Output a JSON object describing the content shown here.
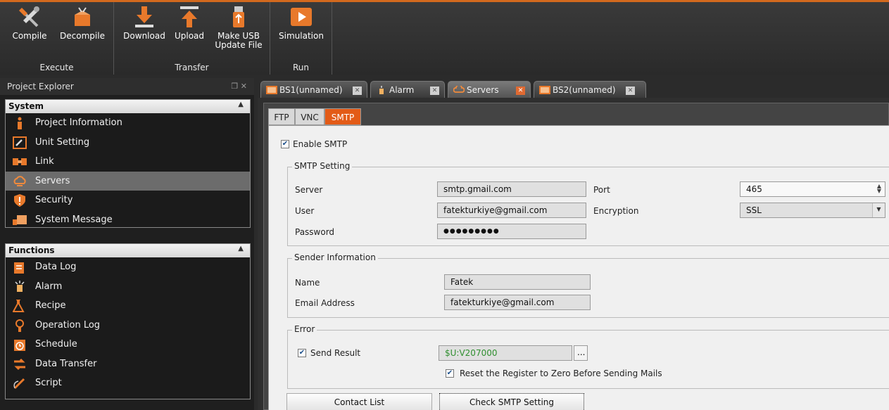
{
  "ribbon": {
    "groups": [
      {
        "label": "Execute",
        "buttons": [
          {
            "label": "Compile"
          },
          {
            "label": "Decompile"
          }
        ]
      },
      {
        "label": "Transfer",
        "buttons": [
          {
            "label": "Download"
          },
          {
            "label": "Upload"
          },
          {
            "label": "Make USB Update File"
          }
        ]
      },
      {
        "label": "Run",
        "buttons": [
          {
            "label": "Simulation"
          }
        ]
      }
    ],
    "accent_color": "#e8792b"
  },
  "explorer": {
    "title": "Project Explorer",
    "controls": "❐ ✕",
    "sections": [
      {
        "title": "System",
        "items": [
          {
            "label": "Project Information",
            "icon": "info-icon"
          },
          {
            "label": "Unit Setting",
            "icon": "wrench-icon"
          },
          {
            "label": "Link",
            "icon": "link-icon"
          },
          {
            "label": "Servers",
            "icon": "cloud-icon",
            "selected": true
          },
          {
            "label": "Security",
            "icon": "shield-icon"
          },
          {
            "label": "System Message",
            "icon": "message-icon"
          }
        ]
      },
      {
        "title": "Functions",
        "items": [
          {
            "label": "Data Log",
            "icon": "datalog-icon"
          },
          {
            "label": "Alarm",
            "icon": "alarm-icon"
          },
          {
            "label": "Recipe",
            "icon": "recipe-icon"
          },
          {
            "label": "Operation Log",
            "icon": "operation-log-icon"
          },
          {
            "label": "Schedule",
            "icon": "clock-icon"
          },
          {
            "label": "Data Transfer",
            "icon": "transfer-icon"
          },
          {
            "label": "Script",
            "icon": "script-icon"
          }
        ]
      }
    ]
  },
  "tabs": [
    {
      "label": "BS1(unnamed)",
      "icon": "screen-icon"
    },
    {
      "label": "Alarm",
      "icon": "alarm-icon"
    },
    {
      "label": "Servers",
      "icon": "cloud-icon",
      "active": true
    },
    {
      "label": "BS2(unnamed)",
      "icon": "screen-icon"
    }
  ],
  "subtabs": [
    {
      "label": "FTP"
    },
    {
      "label": "VNC"
    },
    {
      "label": "SMTP",
      "active": true
    }
  ],
  "smtp": {
    "enable_label": "Enable SMTP",
    "enable_checked": true,
    "setting": {
      "legend": "SMTP Setting",
      "server_label": "Server",
      "server_value": "smtp.gmail.com",
      "port_label": "Port",
      "port_value": "465",
      "user_label": "User",
      "user_value": "fatekturkiye@gmail.com",
      "encryption_label": "Encryption",
      "encryption_value": "SSL",
      "password_label": "Password",
      "password_value": "●●●●●●●●●"
    },
    "sender": {
      "legend": "Sender Information",
      "name_label": "Name",
      "name_value": "Fatek",
      "email_label": "Email Address",
      "email_value": "fatekturkiye@gmail.com"
    },
    "error": {
      "legend": "Error",
      "send_result_label": "Send Result",
      "send_result_checked": true,
      "register_value": "$U:V207000",
      "browse_label": "...",
      "reset_label": "Reset the Register to Zero Before Sending Mails",
      "reset_checked": true
    },
    "buttons": {
      "contact_list": "Contact List",
      "check_smtp": "Check SMTP Setting"
    }
  },
  "checkmark": "✔"
}
